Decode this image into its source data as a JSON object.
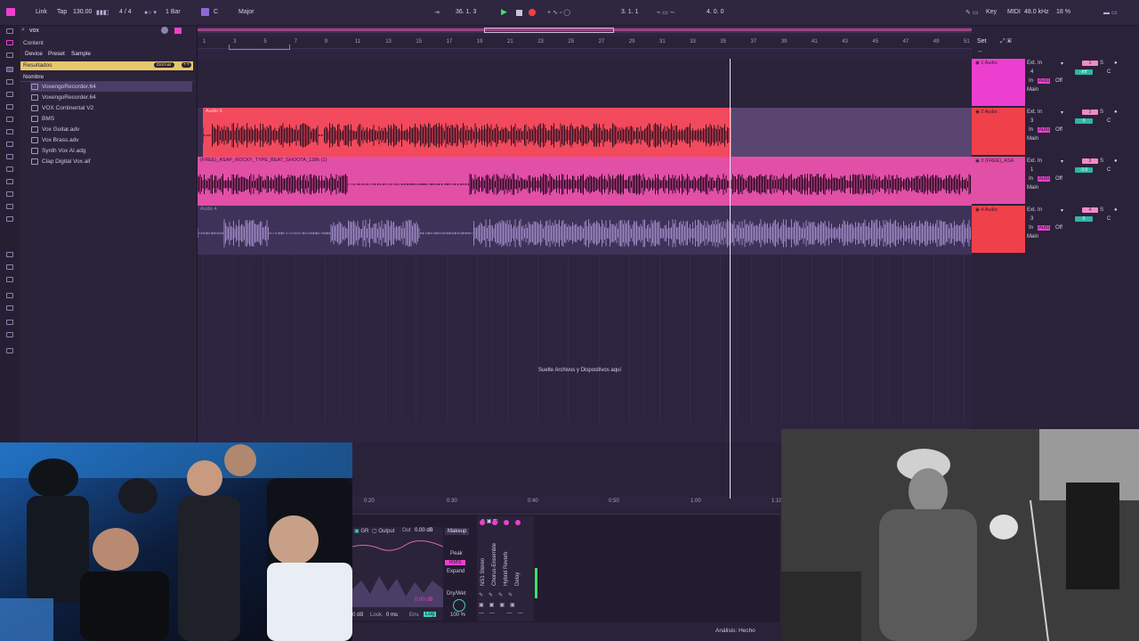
{
  "transport": {
    "link": "Link",
    "tap": "Tap",
    "tempo": "130.00",
    "meter": "4 / 4",
    "quant": "1 Bar",
    "key": "C",
    "scale": "Major",
    "position": "36.  1.  3",
    "loop_start": "3.  1.  1",
    "loop_len": "4.  0.  0",
    "key_btn": "Key",
    "midi_btn": "MIDI",
    "sample_rate": "48.0 kHz",
    "cpu": "18 %"
  },
  "browser": {
    "search": "vox",
    "content_label": "Content",
    "tab_device": "Device",
    "tab_preset": "Preset",
    "tab_sample": "Sample",
    "results": "Resultados",
    "clear": "Borrar",
    "add": "++",
    "col_name": "Nombre",
    "files": [
      "VoxengoRecorder.64",
      "VoxengoRecorder.64",
      "VOX Continental V2",
      "BMS",
      "Vox Guitar.adv",
      "Vox Brass.adv",
      "Synth Vox AI.adg",
      "Clap Digital Vox.aif"
    ]
  },
  "ruler": [
    "1",
    "3",
    "5",
    "7",
    "9",
    "11",
    "13",
    "15",
    "17",
    "19",
    "21",
    "23",
    "25",
    "27",
    "29",
    "31",
    "33",
    "35",
    "37",
    "39",
    "41",
    "43",
    "45",
    "47",
    "49",
    "51"
  ],
  "set_btn": "Set",
  "clips": {
    "audio6": "Audio 6",
    "beat": "(FREE)_ASAP_ROCKY_TYPE_BEAT_SHOOTA_128k (1)",
    "audio4": "Audio 4"
  },
  "drop_hint": "Suelte Archivos y Dispositivos aquí",
  "timeline": [
    "0:20",
    "0:30",
    "0:40",
    "0:50",
    "1:00",
    "1:10"
  ],
  "tracks": [
    {
      "name": "1 Audio",
      "input": "Ext. In",
      "ch": "4",
      "monitor": "In",
      "auto": "Auto",
      "off": "Off",
      "out": "Main",
      "num": "1",
      "vol": "-inf",
      "pan": "C"
    },
    {
      "name": "2 Audio",
      "input": "Ext. In",
      "ch": "3",
      "monitor": "In",
      "auto": "Auto",
      "off": "Off",
      "out": "Main",
      "num": "2",
      "vol": "0",
      "pan": "C"
    },
    {
      "name": "3 (FREE)_ASA",
      "input": "Ext. In",
      "ch": "1",
      "monitor": "In",
      "auto": "Auto",
      "off": "Off",
      "out": "Main",
      "num": "3",
      "vol": "-3.0",
      "pan": "C"
    },
    {
      "name": "4 Audio",
      "input": "Ext. In",
      "ch": "3",
      "monitor": "In",
      "auto": "Auto",
      "off": "Off",
      "out": "Main",
      "num": "4",
      "vol": "0",
      "pan": "C"
    }
  ],
  "device": {
    "gr": "GR",
    "output": "Output",
    "out_label": "Out",
    "out_val": "0.00 dB",
    "makeup": "Makeup",
    "peak": "Peak",
    "rms": "RMS",
    "expand": "Expand",
    "drywet": "Dry/Wet",
    "drywet_val": "100 %",
    "gain": "0.00 dB",
    "look": "Look.",
    "look_val": "0 ms",
    "env": "Env.",
    "log": "Log",
    "db": "0 dB",
    "rack": [
      "NS1 Stereo",
      "Chorus-Ensemble",
      "Hybrid Reverb",
      "Delay"
    ]
  },
  "status": "Análisis: Hecho",
  "colors": {
    "pink": "#ec3fd0",
    "red": "#f0404a",
    "audio6": "#f24a5c",
    "beat": "#e24fa7",
    "purple": "#7a5a9e"
  }
}
